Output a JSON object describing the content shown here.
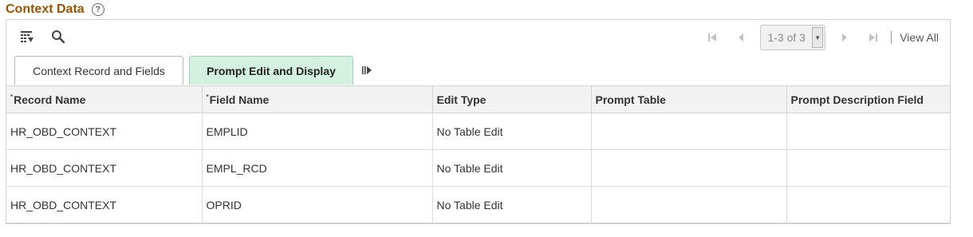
{
  "section": {
    "title": "Context Data",
    "help_glyph": "?"
  },
  "toolbar": {
    "personalize_icon": "grid-personalize-icon",
    "search_icon": "search-icon",
    "row_counter": "1-3 of 3",
    "view_all_label": "View All"
  },
  "tabs": [
    {
      "label": "Context Record and Fields",
      "active": false
    },
    {
      "label": "Prompt Edit and Display",
      "active": true
    }
  ],
  "table": {
    "required_marker": "*",
    "columns": [
      "Record Name",
      "Field Name",
      "Edit Type",
      "Prompt Table",
      "Prompt Description Field"
    ],
    "rows": [
      [
        "HR_OBD_CONTEXT",
        "EMPLID",
        "No Table Edit",
        "",
        ""
      ],
      [
        "HR_OBD_CONTEXT",
        "EMPL_RCD",
        "No Table Edit",
        "",
        ""
      ],
      [
        "HR_OBD_CONTEXT",
        "OPRID",
        "No Table Edit",
        "",
        ""
      ]
    ]
  },
  "colors": {
    "title": "#9c5400",
    "active_tab_bg": "#d4f0e0",
    "header_bg": "#f2f2f2"
  }
}
